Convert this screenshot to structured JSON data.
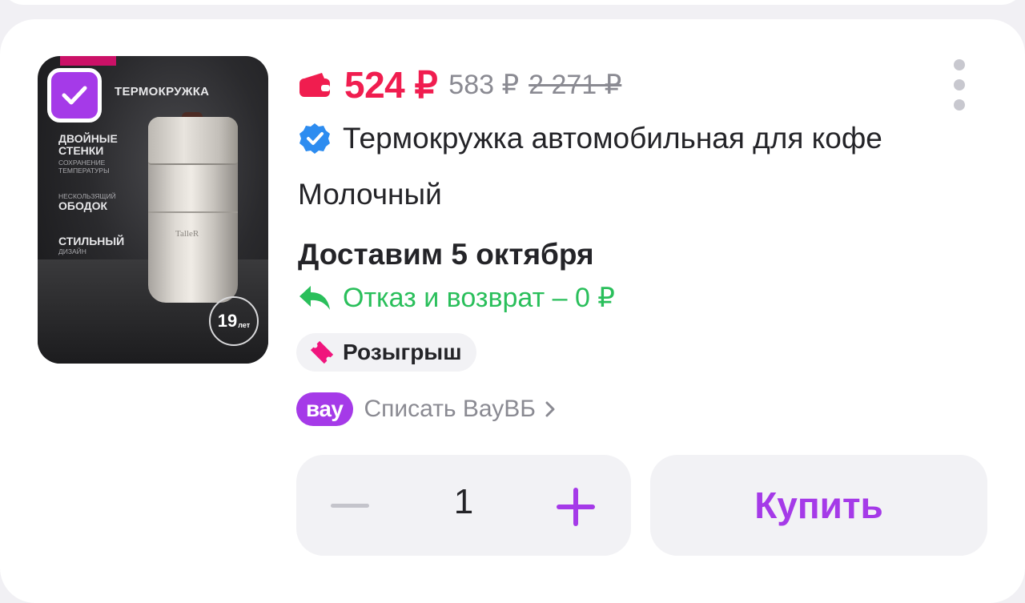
{
  "product_image": {
    "headline": "ТЕРМОКРУЖКА",
    "features": [
      {
        "big": "ДВОЙНЫЕ СТЕНКИ",
        "small": "СОХРАНЕНИЕ ТЕМПЕРАТУРЫ"
      },
      {
        "big": "ОБОДОК",
        "small": "НЕСКОЛЬЗЯЩИЙ"
      },
      {
        "big": "СТИЛЬНЫЙ",
        "small": "ДИЗАЙН"
      }
    ],
    "brand": "TalleR",
    "badge_number": "19",
    "badge_unit": "лет",
    "selected": true
  },
  "price": {
    "current": "524 ₽",
    "wallet_price": "583 ₽",
    "old_price": "2 271 ₽"
  },
  "product": {
    "title": "Термокружка автомобильная для кофе",
    "variant": "Молочный",
    "verified": true
  },
  "delivery": {
    "text": "Доставим 5 октября"
  },
  "returns": {
    "text": "Отказ и возврат – 0 ₽"
  },
  "promo": {
    "raffle_label": "Розыгрыш"
  },
  "vau": {
    "badge": "вау",
    "label": "Списать ВауВБ"
  },
  "cart": {
    "quantity": "1",
    "buy_label": "Купить"
  },
  "colors": {
    "accent": "#a53ae8",
    "price_red": "#f01d4f",
    "green": "#2abf5b",
    "verified_blue": "#2d8cf0",
    "raffle_pink": "#f0157d"
  },
  "icons": {
    "wallet": "wallet-icon",
    "verified": "verified-check-icon",
    "return": "return-arrow-icon",
    "raffle": "ticket-icon",
    "more": "more-vertical-icon",
    "chevron": "chevron-right-icon"
  }
}
